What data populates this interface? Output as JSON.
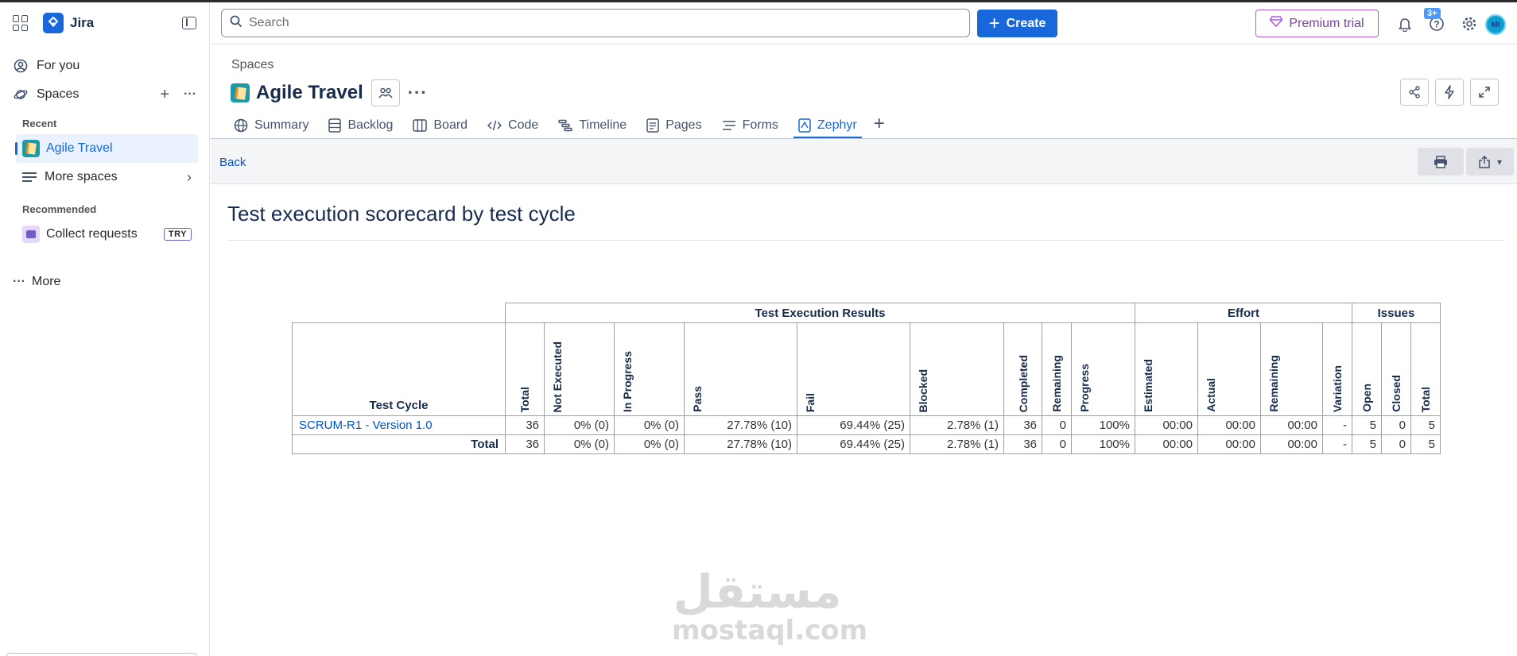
{
  "sidebar": {
    "app_name": "Jira",
    "for_you": "For you",
    "spaces": "Spaces",
    "recent_label": "Recent",
    "recent_item": "Agile Travel",
    "more_spaces": "More spaces",
    "recommended_label": "Recommended",
    "recommended_item": "Collect requests",
    "try_badge": "TRY",
    "more": "More"
  },
  "topnav": {
    "search_placeholder": "Search",
    "create_label": "Create",
    "premium_label": "Premium trial",
    "help_badge": "3+",
    "avatar_initials": "MI"
  },
  "project": {
    "breadcrumb": "Spaces",
    "title": "Agile Travel",
    "tabs": [
      "Summary",
      "Backlog",
      "Board",
      "Code",
      "Timeline",
      "Pages",
      "Forms",
      "Zephyr"
    ],
    "active_tab": "Zephyr"
  },
  "report": {
    "back": "Back",
    "title": "Test execution scorecard by test cycle",
    "groups": [
      "Test Execution Results",
      "Effort",
      "Issues"
    ],
    "row_header": "Test Cycle",
    "columns": [
      "Total",
      "Not Executed",
      "In Progress",
      "Pass",
      "Fail",
      "Blocked",
      "Completed",
      "Remaining",
      "Progress",
      "Estimated",
      "Actual",
      "Remaining",
      "Variation",
      "Open",
      "Closed",
      "Total"
    ],
    "rows": [
      {
        "name": "SCRUM-R1 - Version 1.0",
        "cells": [
          "36",
          "0% (0)",
          "0% (0)",
          "27.78% (10)",
          "69.44% (25)",
          "2.78% (1)",
          "36",
          "0",
          "100%",
          "00:00",
          "00:00",
          "00:00",
          "-",
          "5",
          "0",
          "5"
        ]
      },
      {
        "name": "Total",
        "cells": [
          "36",
          "0% (0)",
          "0% (0)",
          "27.78% (10)",
          "69.44% (25)",
          "2.78% (1)",
          "36",
          "0",
          "100%",
          "00:00",
          "00:00",
          "00:00",
          "-",
          "5",
          "0",
          "5"
        ]
      }
    ]
  },
  "watermark": {
    "arabic": "مستقل",
    "latin": "mostaql.com"
  },
  "colors": {
    "brand": "#1868db",
    "link": "#0052cc",
    "premium": "#af59e1"
  }
}
